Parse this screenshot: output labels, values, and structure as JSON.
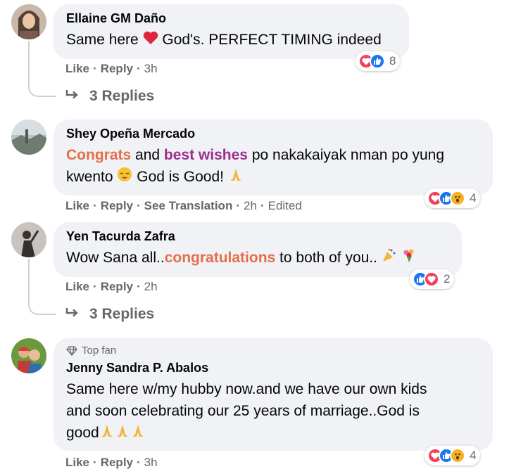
{
  "comments": [
    {
      "author": "Ellaine GM Daño",
      "text_before": "Same here",
      "text_after": "God's. PERFECT TIMING indeed",
      "meta": {
        "like": "Like",
        "reply": "Reply",
        "time": "3h"
      },
      "reaction_count": "8",
      "replies": "3 Replies"
    },
    {
      "author": "Shey Opeña Mercado",
      "text_hl1": "Congrats",
      "text_mid": "and",
      "text_hl2": "best wishes",
      "text_rest1": "po nakakaiyak nman po yung",
      "text_line2": "kwento",
      "text_line2b": "God is Good!",
      "meta": {
        "like": "Like",
        "reply": "Reply",
        "translate": "See Translation",
        "time": "2h",
        "edited": "Edited"
      },
      "reaction_count": "4"
    },
    {
      "author": "Yen Tacurda Zafra",
      "text_before": "Wow Sana all..",
      "text_hl": "congratulations",
      "text_after": "to both of you..",
      "meta": {
        "like": "Like",
        "reply": "Reply",
        "time": "2h"
      },
      "reaction_count": "2",
      "replies": "3 Replies"
    },
    {
      "badge": "Top fan",
      "author": "Jenny Sandra P. Abalos",
      "line1": "Same here w/my hubby now.and we have our own kids",
      "line2": "and soon celebrating our 25 years of marriage..God is",
      "line3": "good",
      "meta": {
        "like": "Like",
        "reply": "Reply",
        "time": "3h"
      },
      "reaction_count": "4"
    }
  ],
  "icons": {
    "love": "love-reaction-icon",
    "like": "like-reaction-icon",
    "wow": "wow-reaction-icon",
    "care": "care-reaction-icon",
    "reply_arrow": "reply-arrow-icon",
    "diamond": "top-fan-diamond-icon"
  },
  "colors": {
    "bubble": "#f0f2f5",
    "meta_text": "#65676b",
    "highlight_orange": "#e46e4b",
    "highlight_purple": "#9c2e8c",
    "love": "#f33e58",
    "like": "#1877f2"
  }
}
